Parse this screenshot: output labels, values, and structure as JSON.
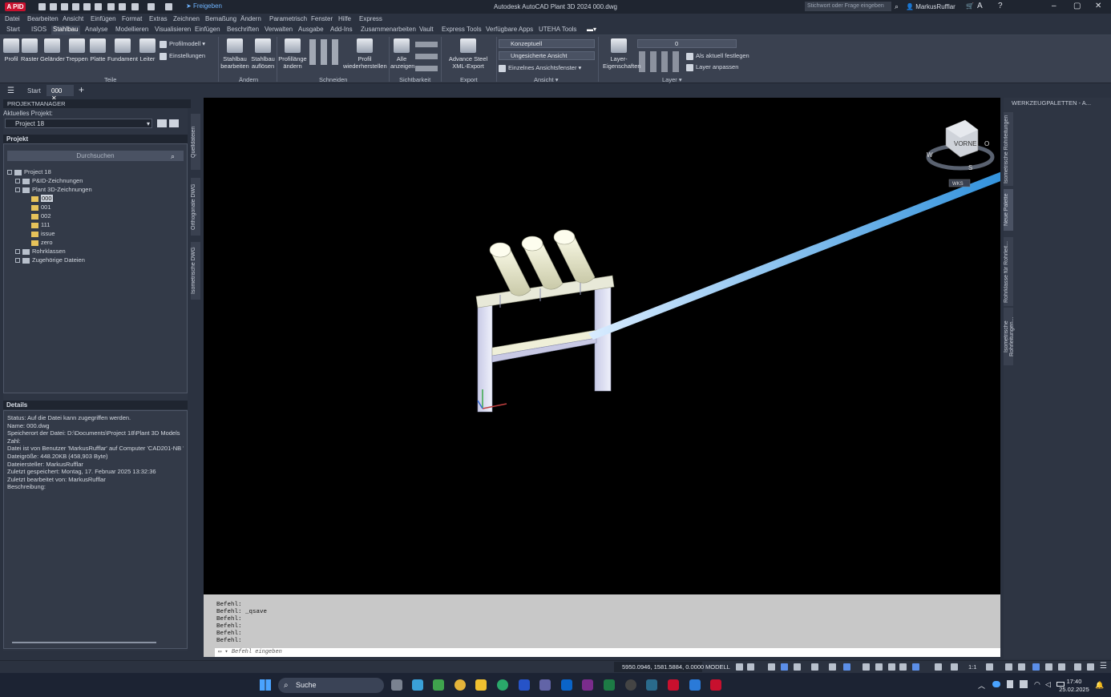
{
  "window": {
    "title": "Autodesk AutoCAD Plant 3D 2024    000.dwg",
    "app_badge": "A PID",
    "share_label": "Freigeben",
    "search_placeholder": "Stichwort oder Frage eingeben",
    "user": "MarkusRufflar"
  },
  "menu": [
    "Datei",
    "Bearbeiten",
    "Ansicht",
    "Einfügen",
    "Format",
    "Extras",
    "Zeichnen",
    "Bemaßung",
    "Ändern",
    "Parametrisch",
    "Fenster",
    "Hilfe",
    "Express"
  ],
  "ribbon_tabs": [
    "Start",
    "ISOS",
    "Stahlbau",
    "Analyse",
    "Modellieren",
    "Visualisieren",
    "Einfügen",
    "Beschriften",
    "Verwalten",
    "Ausgabe",
    "Add-Ins",
    "Zusammenarbeiten",
    "Vault",
    "Express Tools",
    "Verfügbare Apps",
    "UTEHA Tools"
  ],
  "ribbon_active_tab": "Stahlbau",
  "ribbon": {
    "teile": {
      "buttons": [
        "Profil",
        "Raster",
        "Geländer",
        "Treppen",
        "Platte",
        "Fundament",
        "Leiter"
      ],
      "small": [
        "Profilmodell",
        "Einstellungen"
      ],
      "label": "Teile"
    },
    "aendern": {
      "buttons": [
        "Stahlbau bearbeiten",
        "Stahlbau auflösen"
      ],
      "label": "Ändern"
    },
    "schneiden": {
      "buttons": [
        "Profillänge ändern",
        "Profil wiederherstellen"
      ],
      "label": "Schneiden"
    },
    "sichtbarkeit": {
      "buttons": [
        "Alle anzeigen"
      ],
      "label": "Sichtbarkeit"
    },
    "export": {
      "buttons": [
        "Advance Steel XML-Export"
      ],
      "label": "Export"
    },
    "ansicht": {
      "combo1": "Konzeptuell",
      "combo2": "Ungesicherte Ansicht",
      "combo3": "Einzelnes Ansichtsfenster",
      "label": "Ansicht"
    },
    "layer": {
      "buttons": [
        "Layer-Eigenschaften"
      ],
      "combo": "0",
      "small": [
        "Als aktuell festlegen",
        "Layer anpassen"
      ],
      "label": "Layer"
    }
  },
  "doc_tabs": [
    "Start",
    "000"
  ],
  "project_manager": {
    "title": "PROJEKTMANAGER",
    "current_project_label": "Aktuelles Projekt:",
    "current_project": "Project 18",
    "section_label": "Projekt",
    "search_label": "Durchsuchen",
    "tree": [
      {
        "label": "Project 18",
        "level": 0
      },
      {
        "label": "P&ID-Zeichnungen",
        "level": 1
      },
      {
        "label": "Plant 3D-Zeichnungen",
        "level": 1
      },
      {
        "label": "000",
        "level": 2
      },
      {
        "label": "001",
        "level": 2
      },
      {
        "label": "002",
        "level": 2
      },
      {
        "label": "111",
        "level": 2
      },
      {
        "label": "issue",
        "level": 2
      },
      {
        "label": "zero",
        "level": 2
      },
      {
        "label": "Rohrklassen",
        "level": 1
      },
      {
        "label": "Zugehörige Dateien",
        "level": 1
      }
    ],
    "side_tabs": [
      "Quelldateien",
      "Orthogonale DWG",
      "Isometrische DWG"
    ],
    "details_label": "Details",
    "details": [
      "Status: Auf die Datei kann zugegriffen werden.",
      "Name: 000.dwg",
      "Speicherort der Datei: D:\\Documents\\Project 18\\Plant 3D Models",
      "Zahl:",
      "Datei ist von Benutzer 'MarkusRufflar' auf Computer 'CAD201-NB ' i",
      "Dateigröße: 448.20KB (458,903 Byte)",
      "Dateiersteller: MarkusRufflar",
      "Zuletzt gespeichert: Montag, 17. Februar 2025 13:32:36",
      "Zuletzt bearbeitet von: MarkusRufflar",
      "Beschreibung:"
    ]
  },
  "viewcube": {
    "face": "VORNE",
    "n": "N",
    "o": "O",
    "s": "S",
    "w": "W",
    "wcs": "WKS"
  },
  "command_history": [
    "Befehl:",
    "Befehl: _qsave",
    "Befehl:",
    "Befehl:",
    "Befehl:",
    "Befehl:"
  ],
  "command_placeholder": "Befehl eingeben",
  "tool_palette": {
    "title": "WERKZEUGPALETTEN - A...",
    "tabs": [
      "Isometrische Rohrleitungen",
      "Neue Palette",
      "Rohrklasse für Rohrleit...",
      "Isometrische Rohrleitungen..."
    ]
  },
  "status": {
    "coords": "5950.0946, 1581.5884, 0.0000",
    "model": "MODELL",
    "scale": "1:1"
  },
  "taskbar": {
    "search": "Suche",
    "time": "17:40",
    "date": "25.02.2025"
  }
}
